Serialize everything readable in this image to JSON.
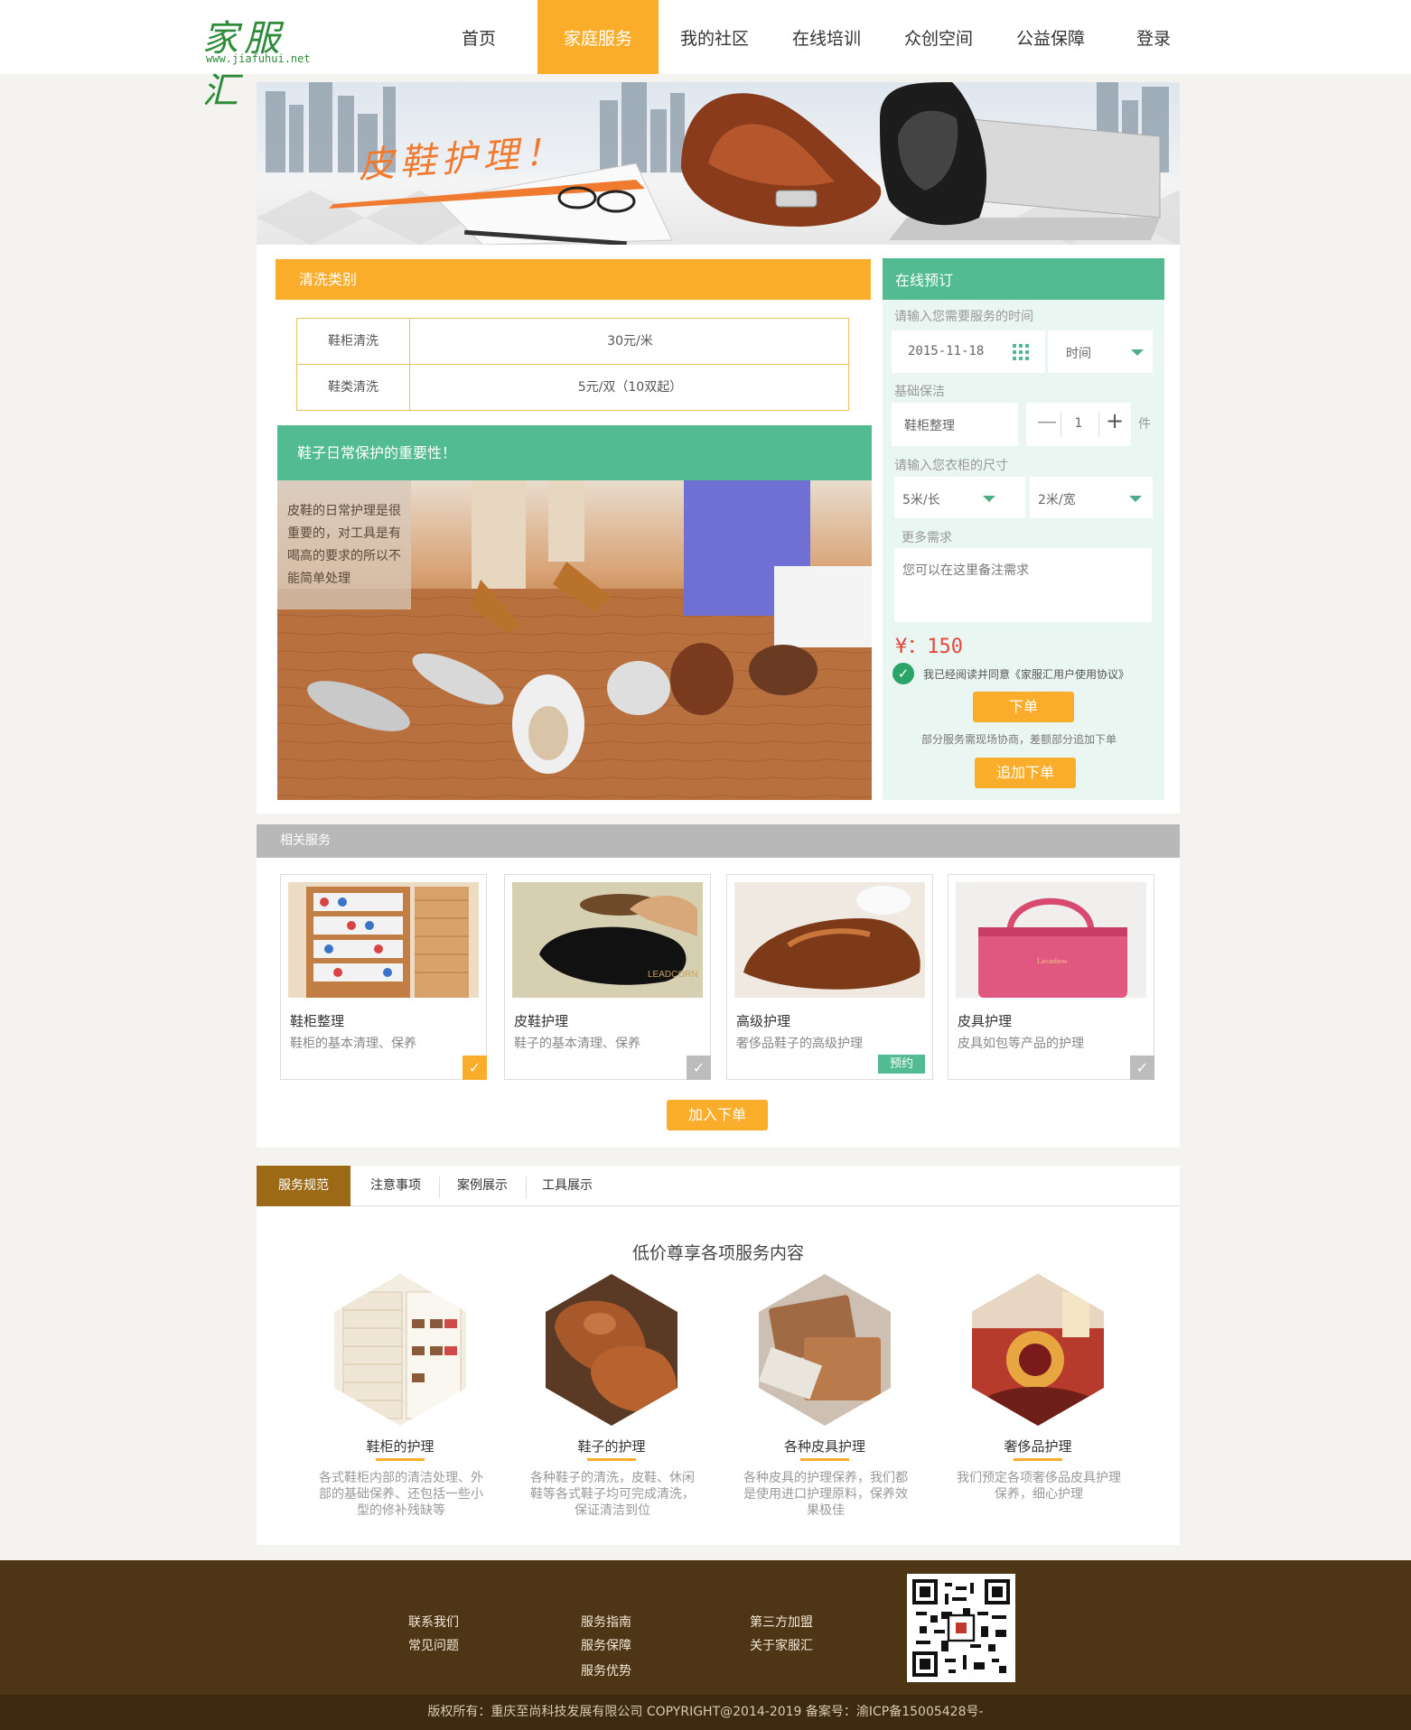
{
  "logo": {
    "text": "家服汇",
    "url": "www.jiafuhui.net"
  },
  "nav": [
    "首页",
    "家庭服务",
    "我的社区",
    "在线培训",
    "众创空间",
    "公益保障",
    "登录"
  ],
  "nav_active": "家庭服务",
  "banner": {
    "title": "皮鞋护理！"
  },
  "cleaning": {
    "title": "清洗类别",
    "rows": [
      {
        "name": "鞋柜清洗",
        "price": "30元/米"
      },
      {
        "name": "鞋类清洗",
        "price": "5元/双（10双起）"
      }
    ]
  },
  "care": {
    "title": "鞋子日常保护的重要性！",
    "note": "皮鞋的日常护理是很重要的，对工具是有喝高的要求的所以不能简单处理"
  },
  "booking": {
    "title": "在线预订",
    "time_label": "请输入您需要服务的时间",
    "date_value": "2015-11-18",
    "time_placeholder": "时间",
    "basic_label": "基础保洁",
    "basic_item": "鞋柜整理",
    "qty": "1",
    "qty_unit": "件",
    "size_label": "请输入您衣柜的尺寸",
    "length": "5米/长",
    "width": "2米/宽",
    "more_label": "更多需求",
    "more_placeholder": "您可以在这里备注需求",
    "price": "¥：150",
    "agree": "我已经阅读并同意《家服汇用户使用协议》",
    "order_btn": "下单",
    "note": "部分服务需现场协商，差额部分追加下单",
    "add_order_btn": "追加下单"
  },
  "related": {
    "title": "相关服务",
    "cards": [
      {
        "title": "鞋柜整理",
        "desc": "鞋柜的基本清理、保养",
        "state": "checked"
      },
      {
        "title": "皮鞋护理",
        "desc": "鞋子的基本清理、保养",
        "state": "unchecked"
      },
      {
        "title": "高级护理",
        "desc": "奢侈品鞋子的高级护理",
        "badge": "预约"
      },
      {
        "title": "皮具护理",
        "desc": "皮具如包等产品的护理",
        "state": "unchecked"
      }
    ],
    "add_btn": "加入下单"
  },
  "tabs": [
    "服务规范",
    "注意事项",
    "案例展示",
    "工具展示"
  ],
  "tab_active": "服务规范",
  "features": {
    "title": "低价尊享各项服务内容",
    "items": [
      {
        "title": "鞋柜的护理",
        "desc": "各式鞋柜内部的清洁处理、外部的基础保养、还包括一些小型的修补残缺等"
      },
      {
        "title": "鞋子的护理",
        "desc": "各种鞋子的清洗，皮鞋、休闲鞋等各式鞋子均可完成清洗，保证清洁到位"
      },
      {
        "title": "各种皮具护理",
        "desc": "各种皮具的护理保养，我们都是使用进口护理原料，保养效果极佳"
      },
      {
        "title": "奢侈品护理",
        "desc": "我们预定各项奢侈品皮具护理保养，细心护理"
      }
    ]
  },
  "footer": {
    "col1": [
      "联系我们",
      "常见问题"
    ],
    "col2": [
      "服务指南",
      "服务保障",
      "服务优势"
    ],
    "col3": [
      "第三方加盟",
      "关于家服汇"
    ],
    "copyright": "版权所有：重庆至尚科技发展有限公司 COPYRIGHT@2014-2019 备案号：渝ICP备15005428号-"
  },
  "colors": {
    "orange": "#f9ad2b",
    "green": "#52bb92",
    "brown": "#9c6a16",
    "footer": "#4d3516",
    "price_red": "#e8463c"
  }
}
